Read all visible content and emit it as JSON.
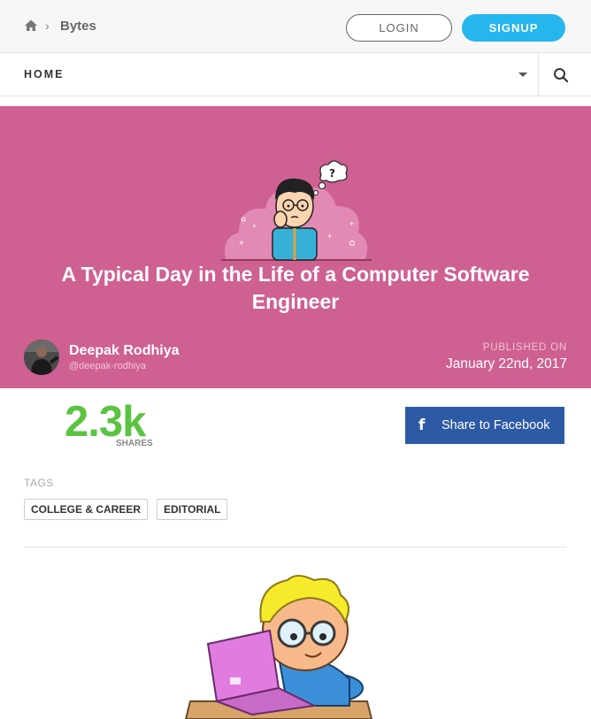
{
  "topbar": {
    "breadcrumb_home_icon": "home-icon",
    "breadcrumb_separator": "›",
    "breadcrumb_title": "Bytes",
    "login_label": "LOGIN",
    "signup_label": "SIGNUP"
  },
  "navbar": {
    "home_label": "HOME",
    "dropdown_icon": "caret-down-icon",
    "search_icon": "search-icon"
  },
  "hero": {
    "background_color": "#cf6092",
    "title": "A Typical Day in the Life of a Computer Software Engineer",
    "author_name": "Deepak Rodhiya",
    "author_handle": "@deepak-rodhiya",
    "published_label": "PUBLISHED ON",
    "published_date": "January 22nd, 2017"
  },
  "shares": {
    "count": "2.3k",
    "label": "SHARES",
    "count_color": "#5ac442"
  },
  "facebook": {
    "icon": "facebook-icon",
    "label": "Share to Facebook",
    "color": "#2d5aa4"
  },
  "tags": {
    "heading": "TAGS",
    "items": [
      "COLLEGE & CAREER",
      "EDITORIAL"
    ]
  },
  "colors": {
    "signup": "#26b6ee"
  }
}
